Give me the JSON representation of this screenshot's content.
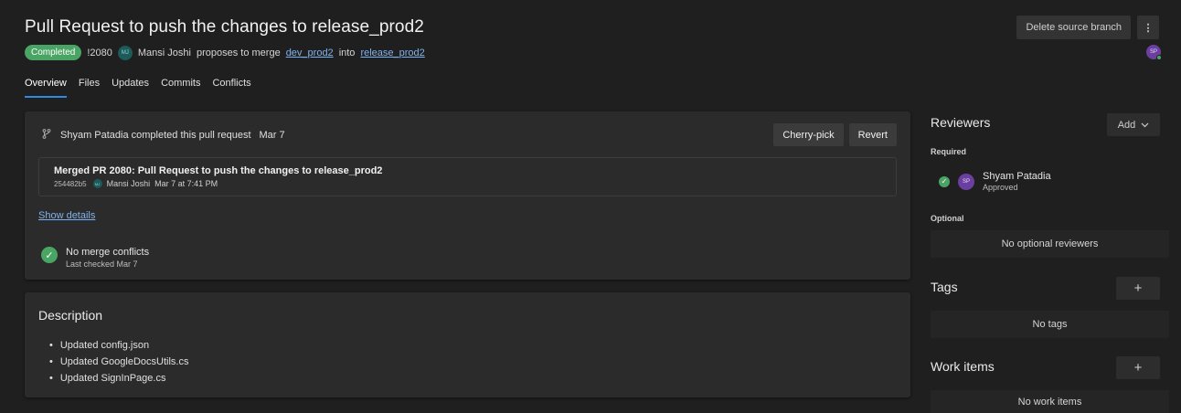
{
  "header": {
    "title": "Pull Request to push the changes to release_prod2",
    "status_badge": "Completed",
    "pr_id": "!2080",
    "author_initials": "MJ",
    "author": "Mansi Joshi",
    "proposes_text": "proposes to merge",
    "source_branch": "dev_prod2",
    "into_text": "into",
    "target_branch": "release_prod2",
    "delete_branch_label": "Delete source branch",
    "more_label": "⋮",
    "user_initials": "SP"
  },
  "tabs": [
    {
      "label": "Overview",
      "active": true
    },
    {
      "label": "Files"
    },
    {
      "label": "Updates"
    },
    {
      "label": "Commits"
    },
    {
      "label": "Conflicts"
    }
  ],
  "status_card": {
    "completed_by": "Shyam Patadia completed this pull request",
    "date": "Mar 7",
    "cherry_pick_label": "Cherry-pick",
    "revert_label": "Revert",
    "commit_title": "Merged PR 2080: Pull Request to push the changes to release_prod2",
    "commit_hash": "254482b5",
    "commit_author_initials": "MJ",
    "commit_author": "Mansi Joshi",
    "commit_time": "Mar 7 at 7:41 PM",
    "show_details": "Show details",
    "conflicts_main": "No merge conflicts",
    "conflicts_sub": "Last checked Mar 7"
  },
  "description": {
    "title": "Description",
    "items": [
      "Updated config.json",
      "Updated GoogleDocsUtils.cs",
      "Updated SignInPage.cs"
    ]
  },
  "sidebar": {
    "reviewers_title": "Reviewers",
    "add_label": "Add",
    "required_label": "Required",
    "reviewer_initials": "SP",
    "reviewer_name": "Shyam Patadia",
    "reviewer_status": "Approved",
    "optional_label": "Optional",
    "no_optional": "No optional reviewers",
    "tags_title": "Tags",
    "no_tags": "No tags",
    "work_items_title": "Work items",
    "no_work_items": "No work items",
    "plus_label": "+"
  },
  "colors": {
    "accent": "#2e8ae6",
    "success": "#4aa564",
    "background": "#1f1f1f",
    "card": "#2b2b2b"
  }
}
